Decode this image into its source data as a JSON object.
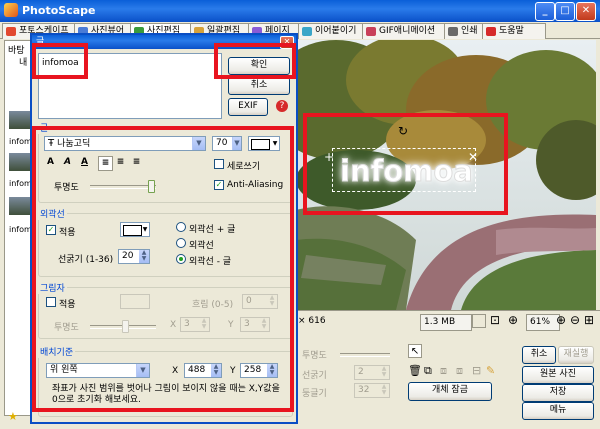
{
  "window": {
    "title": "PhotoScape"
  },
  "tabs": [
    {
      "label": "포토스케이프",
      "icon": "photoscape-icon",
      "color": "#e2492f"
    },
    {
      "label": "사진뷰어",
      "icon": "viewer-icon",
      "color": "#4a7bd6"
    },
    {
      "label": "사진편집",
      "icon": "editor-icon",
      "color": "#3b9b3b"
    },
    {
      "label": "일괄편집",
      "icon": "batch-icon",
      "color": "#d6a23a"
    },
    {
      "label": "페이지",
      "icon": "page-icon",
      "color": "#8a5bd6"
    },
    {
      "label": "이어붙이기",
      "icon": "combine-icon",
      "color": "#3aa6c8"
    },
    {
      "label": "GIF애니메이션",
      "icon": "gif-icon",
      "color": "#c8405a"
    },
    {
      "label": "인쇄",
      "icon": "print-icon",
      "color": "#6a6a6a"
    },
    {
      "label": "도움말",
      "icon": "help-icon",
      "color": "#d62a2a"
    }
  ],
  "left_panel": {
    "header": "바탕",
    "tree_label": "내",
    "thumb_labels": [
      "infom",
      "infom",
      "infom"
    ]
  },
  "dialog": {
    "title": "글",
    "text_value": "infomoa",
    "ok_label": "확인",
    "cancel_label": "취소",
    "exif_label": "EXIF",
    "font_section": {
      "title": "글",
      "font_name": "나눔고딕",
      "font_size": "70",
      "format_buttons": [
        "A",
        "A",
        "A"
      ],
      "vertical_label": "세로쓰기",
      "vertical_checked": false,
      "transparency_label": "투명도",
      "transparency_level": 0.97,
      "anti_alias_label": "Anti-Aliasing",
      "anti_alias_checked": true
    },
    "outline_section": {
      "title": "외곽선",
      "apply_label": "적용",
      "apply_checked": true,
      "width_label": "선굵기 (1-36)",
      "width_value": "20",
      "options": [
        "외곽선 + 글",
        "외곽선",
        "외곽선 - 글"
      ],
      "selected_index": 2
    },
    "shadow_section": {
      "title": "그림자",
      "apply_label": "적용",
      "apply_checked": false,
      "blur_label": "흐림 (0-5)",
      "blur_value": "0",
      "transparency_label": "투명도",
      "x_label": "X",
      "x_value": "3",
      "y_label": "Y",
      "y_value": "3"
    },
    "position_section": {
      "title": "배치기준",
      "anchor_value": "위 왼쪽",
      "x_label": "X",
      "x_value": "488",
      "y_label": "Y",
      "y_value": "258",
      "note": "좌표가 사진 범위를 벗어나 그림이 보이지 않을 때는 X,Y값을 0으로 초기화 해보세요."
    }
  },
  "photo": {
    "overlay_text": "infomoa"
  },
  "status": {
    "dimensions": "× 616",
    "file_size": "1.3 MB",
    "zoom": "61%"
  },
  "bottom_panel": {
    "transparency_label": "투명도",
    "width_label": "선굵기",
    "width_value": "2",
    "roundness_label": "둥글기",
    "roundness_value": "32",
    "object_lock_label": "개체 잠금",
    "cancel_label": "취소",
    "redo_label": "재실행",
    "original_label": "원본 사진",
    "save_label": "저장",
    "menu_label": "메뉴"
  }
}
